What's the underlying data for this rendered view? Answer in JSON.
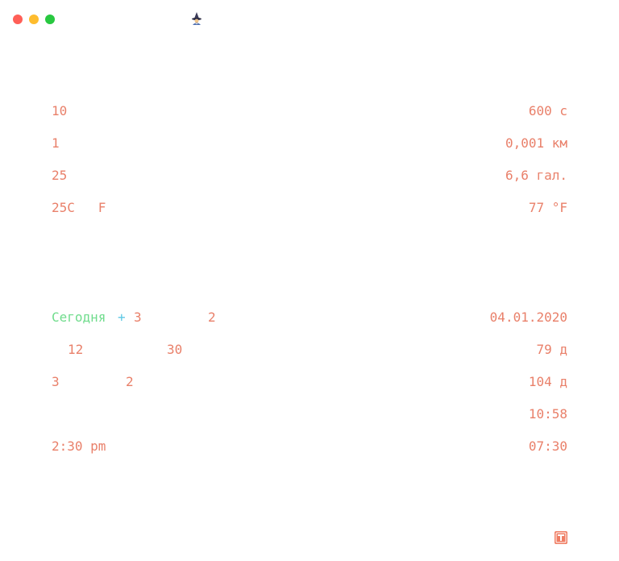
{
  "window": {
    "controls": [
      "close",
      "minimize",
      "maximize"
    ],
    "app_icon": "wizard-icon"
  },
  "conversions": [
    {
      "input": "10",
      "result": "600 с"
    },
    {
      "input": "1",
      "result": "0,001 км"
    },
    {
      "input": "25",
      "result": "6,6 гал."
    },
    {
      "input": "25C   F",
      "result": "77 °F"
    }
  ],
  "dates": {
    "today_keyword": "Сегодня",
    "plus_operator": "+",
    "row1_num_a": "3",
    "row1_num_b": "2",
    "row1_result": "04.01.2020",
    "row2_num_a": "12",
    "row2_num_b": "30",
    "row2_result": "79 д",
    "row3_num_a": "3",
    "row3_num_b": "2",
    "row3_result": "104 д",
    "row4_result": "10:58",
    "row5_input": "2:30 pm",
    "row5_result": "07:30"
  },
  "colors": {
    "accent": "#e9806a",
    "keyword": "#6fdc8c",
    "operator": "#5ec8e5",
    "badge": "#ef7d63"
  },
  "footer": {
    "badge_icon": "text-t-icon"
  }
}
